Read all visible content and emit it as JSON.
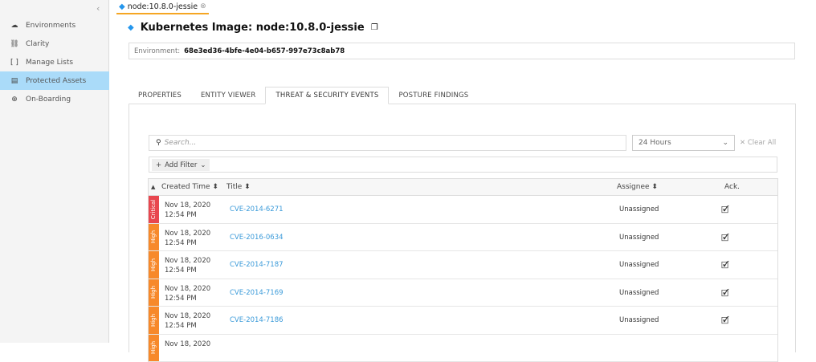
{
  "sidebar": {
    "collapse_icon": "‹",
    "items": [
      {
        "label": "Environments",
        "icon": "☁"
      },
      {
        "label": "Clarity",
        "icon": "⛓"
      },
      {
        "label": "Manage Lists",
        "icon": "[ ]"
      },
      {
        "label": "Protected Assets",
        "icon": "▤",
        "active": true
      },
      {
        "label": "On-Boarding",
        "icon": "⊕"
      }
    ]
  },
  "page_tab": {
    "label": "node:10.8.0-jessie"
  },
  "header": {
    "title": "Kubernetes Image: node:10.8.0-jessie",
    "env_label": "Environment:",
    "env_value": "68e3ed36-4bfe-4e04-b657-997e73c8ab78"
  },
  "tabs": [
    "PROPERTIES",
    "ENTITY VIEWER",
    "THREAT & SECURITY EVENTS",
    "POSTURE FINDINGS"
  ],
  "active_tab": 2,
  "toolbar": {
    "search_placeholder": "Search...",
    "time_range": "24 Hours",
    "clear_all": "✕ Clear All",
    "add_filter": "Add Filter"
  },
  "table": {
    "columns": {
      "created": "Created Time",
      "title": "Title",
      "assignee": "Assignee",
      "ack": "Ack."
    },
    "rows": [
      {
        "severity": "Critical",
        "date": "Nov 18, 2020",
        "time": "12:54 PM",
        "title": "CVE-2014-6271",
        "assignee": "Unassigned"
      },
      {
        "severity": "High",
        "date": "Nov 18, 2020",
        "time": "12:54 PM",
        "title": "CVE-2016-0634",
        "assignee": "Unassigned"
      },
      {
        "severity": "High",
        "date": "Nov 18, 2020",
        "time": "12:54 PM",
        "title": "CVE-2014-7187",
        "assignee": "Unassigned"
      },
      {
        "severity": "High",
        "date": "Nov 18, 2020",
        "time": "12:54 PM",
        "title": "CVE-2014-7169",
        "assignee": "Unassigned"
      },
      {
        "severity": "High",
        "date": "Nov 18, 2020",
        "time": "12:54 PM",
        "title": "CVE-2014-7186",
        "assignee": "Unassigned"
      },
      {
        "severity": "High",
        "date": "Nov 18, 2020",
        "time": "",
        "title": "",
        "assignee": ""
      }
    ]
  },
  "colors": {
    "critical": "#e8474f",
    "high": "#f7892b",
    "active_nav": "#aadbf9",
    "tab_underline": "#f5a623",
    "link": "#3a9ad9"
  }
}
